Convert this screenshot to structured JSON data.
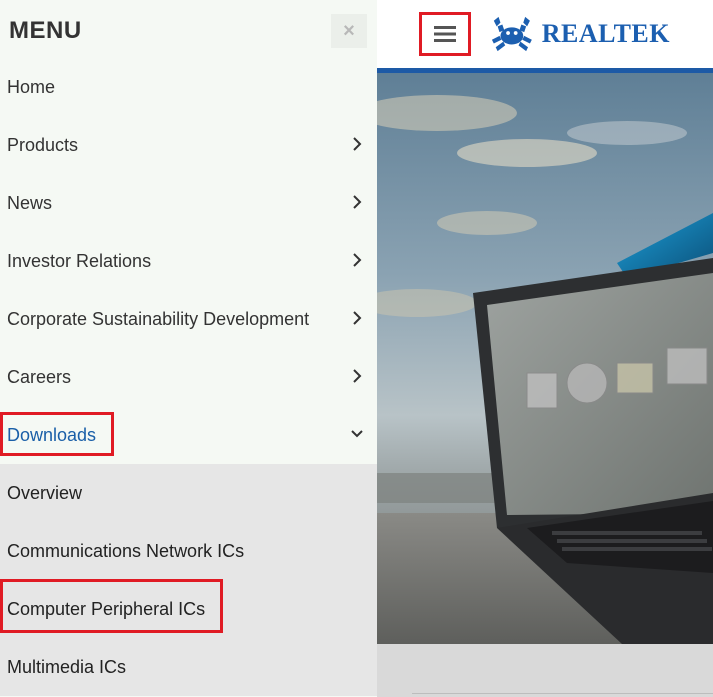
{
  "menu": {
    "title": "MENU",
    "close_label": "×",
    "items": [
      {
        "label": "Home"
      },
      {
        "label": "Products"
      },
      {
        "label": "News"
      },
      {
        "label": "Investor Relations"
      },
      {
        "label": "Corporate Sustainability Development"
      },
      {
        "label": "Careers"
      },
      {
        "label": "Downloads"
      }
    ],
    "submenu": [
      {
        "label": "Overview"
      },
      {
        "label": "Communications Network ICs"
      },
      {
        "label": "Computer Peripheral ICs"
      },
      {
        "label": "Multimedia ICs"
      }
    ]
  },
  "header": {
    "brand": "REALTEK",
    "menu_icon": "hamburger-icon",
    "brand_color": "#1c5fb0"
  },
  "colors": {
    "accent": "#1a5fa8",
    "highlight": "#e01b24",
    "header_bar": "#1d5aa6"
  }
}
